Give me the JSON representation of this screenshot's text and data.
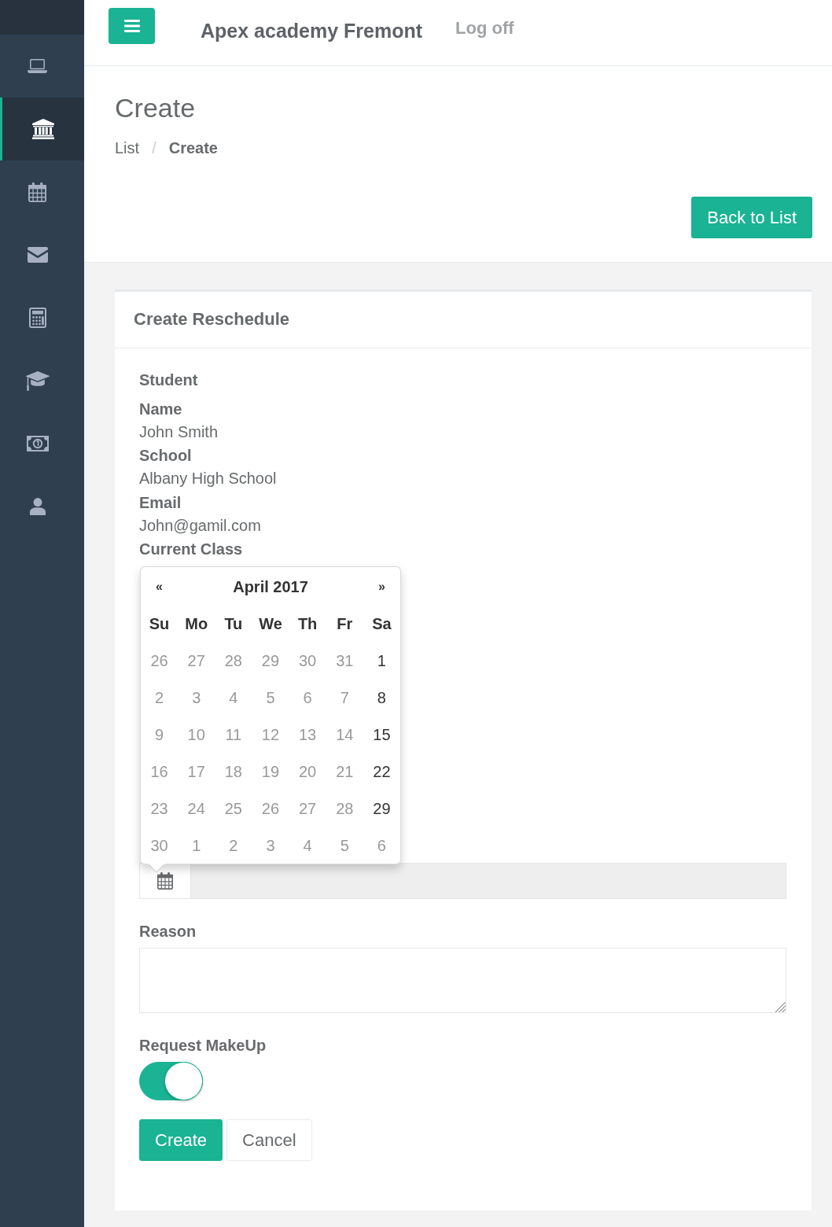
{
  "sidebar": {
    "items": [
      {
        "kind": "laptop",
        "selected": false
      },
      {
        "kind": "bank",
        "selected": true
      },
      {
        "kind": "calendar",
        "selected": false
      },
      {
        "kind": "envelope",
        "selected": false
      },
      {
        "kind": "calculator",
        "selected": false
      },
      {
        "kind": "graduation-cap",
        "selected": false
      },
      {
        "kind": "money",
        "selected": false
      },
      {
        "kind": "user",
        "selected": false
      }
    ]
  },
  "header": {
    "title": "Apex academy Fremont",
    "logoff": "Log off"
  },
  "page": {
    "heading": "Create",
    "breadcrumb": {
      "separator": "/",
      "items": [
        {
          "label": "List",
          "active": false
        },
        {
          "label": "Create",
          "active": true
        }
      ]
    },
    "back_button": "Back to List"
  },
  "card": {
    "title": "Create Reschedule",
    "section": "Student",
    "fields": [
      {
        "label": "Name",
        "value": "John Smith"
      },
      {
        "label": "School",
        "value": "Albany High School"
      },
      {
        "label": "Email",
        "value": "John@gamil.com"
      },
      {
        "label": "Current Class"
      }
    ]
  },
  "date_field": {
    "readonly": true
  },
  "datepicker": {
    "prev": "«",
    "month": "April 2017",
    "next": "»",
    "weekdays": [
      "Su",
      "Mo",
      "Tu",
      "We",
      "Th",
      "Fr",
      "Sa"
    ],
    "weeks": [
      {
        "days": [
          {
            "day": "26",
            "disabled": true
          },
          {
            "day": "27",
            "disabled": true
          },
          {
            "day": "28",
            "disabled": true
          },
          {
            "day": "29",
            "disabled": true
          },
          {
            "day": "30",
            "disabled": true
          },
          {
            "day": "31",
            "disabled": true
          },
          {
            "day": "1",
            "disabled": false
          }
        ]
      },
      {
        "days": [
          {
            "day": "2",
            "disabled": true
          },
          {
            "day": "3",
            "disabled": true
          },
          {
            "day": "4",
            "disabled": true
          },
          {
            "day": "5",
            "disabled": true
          },
          {
            "day": "6",
            "disabled": true
          },
          {
            "day": "7",
            "disabled": true
          },
          {
            "day": "8",
            "disabled": false
          }
        ]
      },
      {
        "days": [
          {
            "day": "9",
            "disabled": true
          },
          {
            "day": "10",
            "disabled": true
          },
          {
            "day": "11",
            "disabled": true
          },
          {
            "day": "12",
            "disabled": true
          },
          {
            "day": "13",
            "disabled": true
          },
          {
            "day": "14",
            "disabled": true
          },
          {
            "day": "15",
            "disabled": false
          }
        ]
      },
      {
        "days": [
          {
            "day": "16",
            "disabled": true
          },
          {
            "day": "17",
            "disabled": true
          },
          {
            "day": "18",
            "disabled": true
          },
          {
            "day": "19",
            "disabled": true
          },
          {
            "day": "20",
            "disabled": true
          },
          {
            "day": "21",
            "disabled": true
          },
          {
            "day": "22",
            "disabled": false
          }
        ]
      },
      {
        "days": [
          {
            "day": "23",
            "disabled": true
          },
          {
            "day": "24",
            "disabled": true
          },
          {
            "day": "25",
            "disabled": true
          },
          {
            "day": "26",
            "disabled": true
          },
          {
            "day": "27",
            "disabled": true
          },
          {
            "day": "28",
            "disabled": true
          },
          {
            "day": "29",
            "disabled": false
          }
        ]
      },
      {
        "days": [
          {
            "day": "30",
            "disabled": true
          },
          {
            "day": "1",
            "disabled": true
          },
          {
            "day": "2",
            "disabled": true
          },
          {
            "day": "3",
            "disabled": true
          },
          {
            "day": "4",
            "disabled": true
          },
          {
            "day": "5",
            "disabled": true
          },
          {
            "day": "6",
            "disabled": true
          }
        ]
      }
    ]
  },
  "reason": {
    "label": "Reason"
  },
  "request_makeup": {
    "label": "Request MakeUp",
    "on": true
  },
  "buttons": [
    {
      "label": "Create",
      "kind": "primary"
    },
    {
      "label": "Cancel",
      "kind": "default"
    }
  ]
}
